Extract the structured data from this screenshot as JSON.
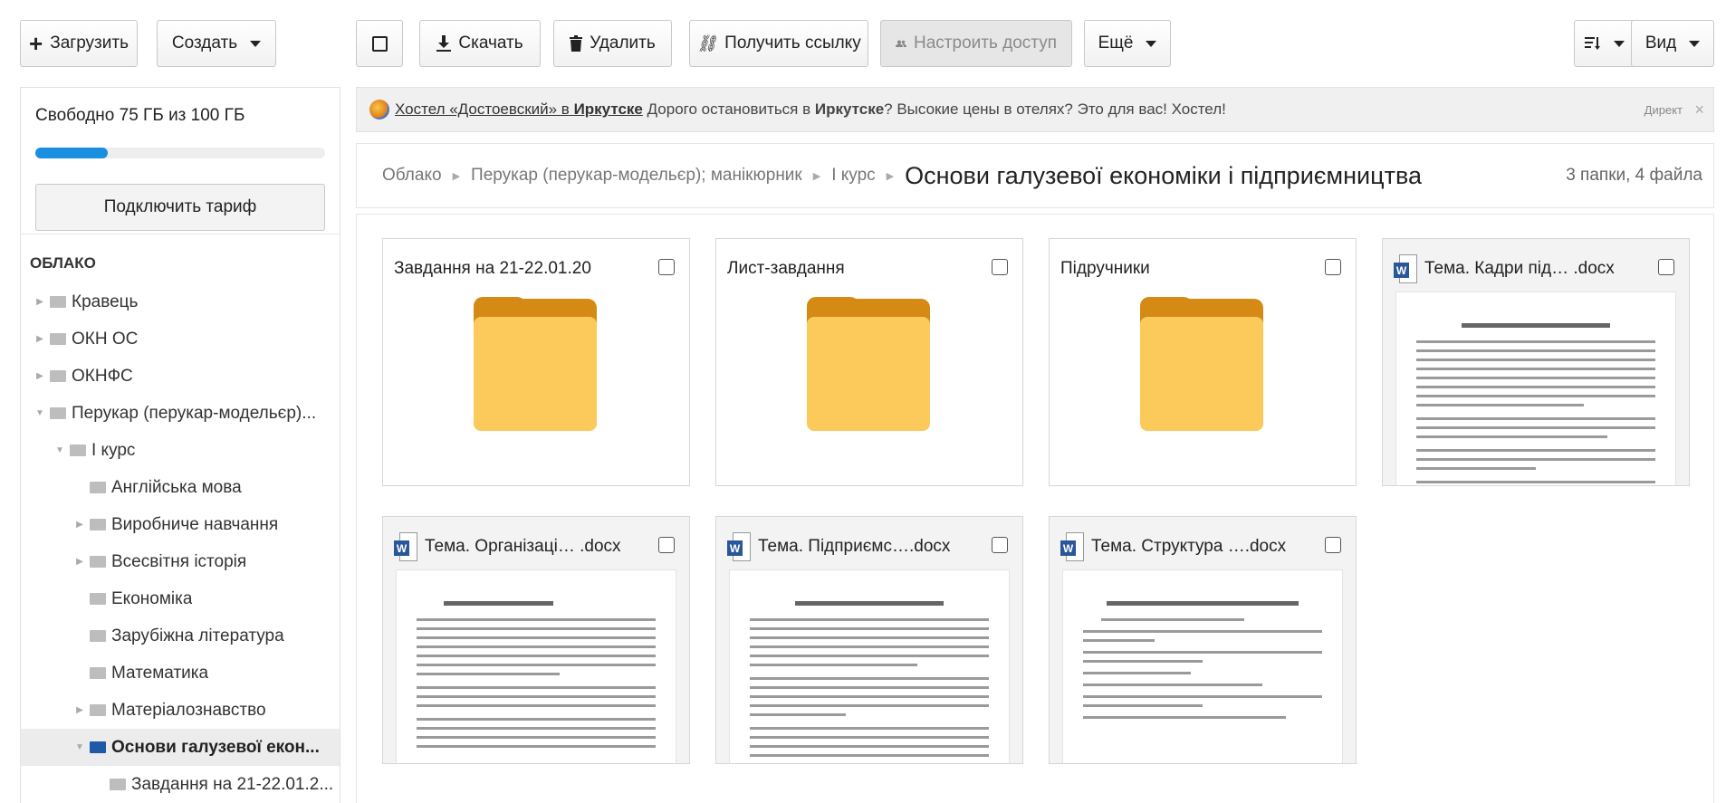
{
  "toolbar": {
    "upload": "Загрузить",
    "create": "Создать",
    "download": "Скачать",
    "delete": "Удалить",
    "get_link": "Получить ссылку",
    "access": "Настроить доступ",
    "more": "Ещё",
    "view": "Вид"
  },
  "sidebar": {
    "space_text": "Свободно 75 ГБ из 100 ГБ",
    "space_used_fraction": 0.25,
    "tariff_button": "Подключить тариф",
    "tree_title": "ОБЛАКО",
    "items": [
      {
        "label": "Кравець",
        "expandable": true
      },
      {
        "label": "ОКН ОС",
        "expandable": true
      },
      {
        "label": "ОКНФС",
        "expandable": true
      },
      {
        "label": "Перукар (перукар-модельєр)...",
        "expandable": true
      },
      {
        "label": "І курс",
        "expandable": true
      },
      {
        "label": "Англійська мова",
        "expandable": false
      },
      {
        "label": "Виробниче навчання",
        "expandable": true
      },
      {
        "label": "Всесвітня історія",
        "expandable": true
      },
      {
        "label": "Економіка",
        "expandable": false
      },
      {
        "label": "Зарубіжна література",
        "expandable": false
      },
      {
        "label": "Математика",
        "expandable": false
      },
      {
        "label": "Матеріалознавство",
        "expandable": true
      },
      {
        "label": "Основи галузевої екон...",
        "expandable": true
      },
      {
        "label": "Завдання на 21-22.01.2...",
        "expandable": false
      }
    ]
  },
  "ad": {
    "link": "Хостел «Достоевский» в",
    "link_bold": "Иркутске",
    "text1": " Дорого остановиться в ",
    "text_bold": "Иркутске",
    "text2": "? Высокие цены в отелях? Это для вас! Хостел!",
    "label": "Директ",
    "close": "×"
  },
  "breadcrumbs": {
    "items": [
      "Облако",
      "Перукар (перукар-модельєр); манікюрник",
      "І курс"
    ],
    "current": "Основи галузевої економіки і підприємництва",
    "count": "3 папки, 4 файла"
  },
  "files": [
    {
      "name": "Завдання на 21-22.01.20",
      "type": "folder"
    },
    {
      "name": "Лист-завдання",
      "type": "folder"
    },
    {
      "name": "Підручники",
      "type": "folder"
    },
    {
      "name": "Тема. Кадри під… .docx",
      "type": "docx"
    },
    {
      "name": "Тема. Організаці… .docx",
      "type": "docx"
    },
    {
      "name": "Тема. Підприємс….docx",
      "type": "docx"
    },
    {
      "name": "Тема. Структура ….docx",
      "type": "docx"
    }
  ],
  "icons": {
    "upload": "plus-icon",
    "select_all": "checkbox-icon",
    "download": "download-icon",
    "delete": "trash-icon",
    "link": "link-icon",
    "access": "users-icon",
    "sort": "sort-icon",
    "word": "W"
  },
  "colors": {
    "accent": "#1a8fe0",
    "folder_front": "#fcc95b",
    "folder_back": "#d48a14",
    "word_blue": "#2b579a",
    "selected_folder": "#1e5aa8"
  }
}
